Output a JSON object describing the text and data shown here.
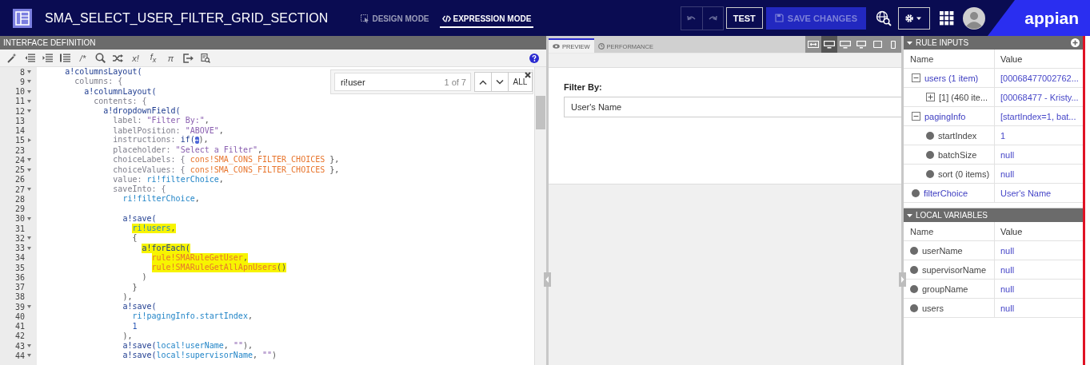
{
  "header": {
    "title": "SMA_SELECT_USER_FILTER_GRID_SECTION",
    "modes": [
      {
        "label": "DESIGN MODE",
        "kind": "design",
        "selected": false
      },
      {
        "label": "EXPRESSION MODE",
        "kind": "expression",
        "selected": true
      }
    ],
    "test": "TEST",
    "save": {
      "label": "SAVE CHANGES",
      "disabled": true
    },
    "logo": "appian"
  },
  "editor": {
    "title": "INTERFACE DEFINITION",
    "toolbar": [
      {
        "kind": "wand"
      },
      {
        "kind": "outdent"
      },
      {
        "kind": "indent"
      },
      {
        "kind": "lines"
      },
      {
        "kind": "text",
        "label": "/*"
      },
      {
        "kind": "search"
      },
      {
        "kind": "shuffle"
      },
      {
        "kind": "text",
        "label": "x!"
      },
      {
        "kind": "text",
        "label": "f$_{x}$"
      },
      {
        "kind": "text",
        "label": "π"
      },
      {
        "kind": "export"
      },
      {
        "kind": "inspect"
      }
    ],
    "find": {
      "value": "ri!user",
      "count": "1 of 7",
      "all": "ALL"
    },
    "lines": [
      {
        "num": "8",
        "expanded": true,
        "highlighted": false,
        "tokens": [
          {
            "kind": "fn",
            "text": "      a!columnsLayout("
          }
        ]
      },
      {
        "num": "9",
        "expanded": true,
        "highlighted": false,
        "tokens": [
          {
            "kind": "key",
            "text": "        columns: {"
          }
        ]
      },
      {
        "num": "10",
        "expanded": true,
        "highlighted": false,
        "tokens": [
          {
            "kind": "fn",
            "text": "          a!columnLayout("
          }
        ]
      },
      {
        "num": "11",
        "expanded": true,
        "highlighted": false,
        "tokens": [
          {
            "kind": "key",
            "text": "            contents: {"
          }
        ]
      },
      {
        "num": "12",
        "expanded": true,
        "highlighted": false,
        "tokens": [
          {
            "kind": "fn",
            "text": "              a!dropdownField("
          }
        ]
      },
      {
        "num": "13",
        "highlighted": false,
        "tokens": [
          {
            "kind": "key",
            "text": "                label: "
          },
          {
            "kind": "str",
            "text": "\"Filter By:\""
          },
          {
            "kind": "punct",
            "text": ","
          }
        ]
      },
      {
        "num": "14",
        "highlighted": false,
        "tokens": [
          {
            "kind": "key",
            "text": "                labelPosition: "
          },
          {
            "kind": "str",
            "text": "\"ABOVE\""
          },
          {
            "kind": "punct",
            "text": ","
          }
        ]
      },
      {
        "num": "15",
        "expanded": false,
        "highlighted": false,
        "tokens": [
          {
            "kind": "key",
            "text": "                instructions: "
          },
          {
            "kind": "fn",
            "text": "if("
          },
          {
            "kind": "folded",
            "text": "↔"
          },
          {
            "kind": "punct",
            "text": "),"
          }
        ]
      },
      {
        "num": "23",
        "highlighted": false,
        "tokens": [
          {
            "kind": "key",
            "text": "                placeholder: "
          },
          {
            "kind": "str",
            "text": "\"Select a Filter\""
          },
          {
            "kind": "punct",
            "text": ","
          }
        ]
      },
      {
        "num": "24",
        "expanded": true,
        "highlighted": false,
        "tokens": [
          {
            "kind": "key",
            "text": "                choiceLabels: { "
          },
          {
            "kind": "const",
            "text": "cons!SMA_CONS_FILTER_CHOICES"
          },
          {
            "kind": "punct",
            "text": " },"
          }
        ]
      },
      {
        "num": "25",
        "expanded": true,
        "highlighted": false,
        "tokens": [
          {
            "kind": "key",
            "text": "                choiceValues: { "
          },
          {
            "kind": "const",
            "text": "cons!SMA_CONS_FILTER_CHOICES"
          },
          {
            "kind": "punct",
            "text": " },"
          }
        ]
      },
      {
        "num": "26",
        "highlighted": false,
        "tokens": [
          {
            "kind": "key",
            "text": "                value: "
          },
          {
            "kind": "ref",
            "text": "ri!filterChoice"
          },
          {
            "kind": "punct",
            "text": ","
          }
        ]
      },
      {
        "num": "27",
        "expanded": true,
        "highlighted": false,
        "tokens": [
          {
            "kind": "key",
            "text": "                saveInto: {"
          }
        ]
      },
      {
        "num": "28",
        "highlighted": false,
        "tokens": [
          {
            "kind": "ref",
            "text": "                  ri!filterChoice"
          },
          {
            "kind": "punct",
            "text": ","
          }
        ]
      },
      {
        "num": "29"
      },
      {
        "num": "30",
        "expanded": true,
        "highlighted": false,
        "tokens": [
          {
            "kind": "fn",
            "text": "                  a!save("
          }
        ]
      },
      {
        "num": "31",
        "highlighted": true,
        "tokens": [
          {
            "kind": "ref",
            "text": "                    ri!users"
          },
          {
            "kind": "punct",
            "text": ","
          }
        ]
      },
      {
        "num": "32",
        "expanded": true,
        "highlighted": false,
        "tokens": [
          {
            "kind": "punct",
            "text": "                    {"
          }
        ]
      },
      {
        "num": "33",
        "expanded": true,
        "highlighted": true,
        "tokens": [
          {
            "kind": "fn",
            "text": "                      a!forEach("
          }
        ]
      },
      {
        "num": "34",
        "highlighted": true,
        "tokens": [
          {
            "kind": "const",
            "text": "                        rule!SMARuleGetUser"
          },
          {
            "kind": "punct",
            "text": ","
          }
        ]
      },
      {
        "num": "35",
        "highlighted": true,
        "tokens": [
          {
            "kind": "const",
            "text": "                        rule!SMARuleGetAllApnUsers"
          },
          {
            "kind": "punct",
            "text": "()"
          }
        ]
      },
      {
        "num": "36",
        "highlighted": false,
        "tokens": [
          {
            "kind": "punct",
            "text": "                      )"
          }
        ]
      },
      {
        "num": "37",
        "highlighted": false,
        "tokens": [
          {
            "kind": "punct",
            "text": "                    }"
          }
        ]
      },
      {
        "num": "38",
        "highlighted": false,
        "tokens": [
          {
            "kind": "punct",
            "text": "                  ),"
          }
        ]
      },
      {
        "num": "39",
        "expanded": true,
        "highlighted": false,
        "tokens": [
          {
            "kind": "fn",
            "text": "                  a!save("
          }
        ]
      },
      {
        "num": "40",
        "highlighted": false,
        "tokens": [
          {
            "kind": "ref",
            "text": "                    ri!pagingInfo.startIndex"
          },
          {
            "kind": "punct",
            "text": ","
          }
        ]
      },
      {
        "num": "41",
        "highlighted": false,
        "tokens": [
          {
            "kind": "num",
            "text": "                    1"
          }
        ]
      },
      {
        "num": "42",
        "highlighted": false,
        "tokens": [
          {
            "kind": "punct",
            "text": "                  ),"
          }
        ]
      },
      {
        "num": "43",
        "expanded": true,
        "highlighted": false,
        "tokens": [
          {
            "kind": "fn",
            "text": "                  a!save("
          },
          {
            "kind": "ref",
            "text": "local!userName"
          },
          {
            "kind": "punct",
            "text": ", "
          },
          {
            "kind": "str",
            "text": "\"\""
          },
          {
            "kind": "punct",
            "text": "),"
          }
        ]
      },
      {
        "num": "44",
        "expanded": true,
        "highlighted": false,
        "tokens": [
          {
            "kind": "fn",
            "text": "                  a!save("
          },
          {
            "kind": "ref",
            "text": "local!supervisorName"
          },
          {
            "kind": "punct",
            "text": ", "
          },
          {
            "kind": "str",
            "text": "\"\""
          },
          {
            "kind": "punct",
            "text": ")"
          }
        ]
      }
    ]
  },
  "preview": {
    "tabs": [
      {
        "label": "PREVIEW",
        "kind": "preview",
        "selected": true
      },
      {
        "label": "PERFORMANCE",
        "kind": "performance",
        "selected": false
      }
    ],
    "devices": [
      {
        "kind": "fit",
        "selected": false
      },
      {
        "kind": "desktop",
        "selected": true
      },
      {
        "kind": "desktop",
        "selected": false
      },
      {
        "kind": "monitor",
        "selected": false
      },
      {
        "kind": "tablet",
        "selected": false
      },
      {
        "kind": "phone",
        "selected": false
      }
    ],
    "field": {
      "label": "Filter By:",
      "value": "User's Name"
    }
  },
  "rule_inputs": {
    "title": "RULE INPUTS",
    "columns": [
      "Name",
      "Value"
    ],
    "items": [
      {
        "name": "users (1 item)",
        "value": "[00068477002762...",
        "expanded": true,
        "children": [
          {
            "name": "[1] (460 ite...",
            "value": "[00068477 - Kristy...",
            "expanded": false
          }
        ]
      },
      {
        "name": "pagingInfo",
        "value": "[startIndex=1, bat...",
        "expanded": true,
        "children": [
          {
            "name": "startIndex",
            "value": "1"
          },
          {
            "name": "batchSize",
            "value": "null"
          },
          {
            "name": "sort (0 items)",
            "value": "null"
          }
        ]
      },
      {
        "name": "filterChoice",
        "value": "User's Name"
      }
    ]
  },
  "local_variables": {
    "title": "LOCAL VARIABLES",
    "columns": [
      "Name",
      "Value"
    ],
    "items": [
      {
        "name": "userName",
        "value": "null"
      },
      {
        "name": "supervisorName",
        "value": "null"
      },
      {
        "name": "groupName",
        "value": "null"
      },
      {
        "name": "users",
        "value": "null"
      }
    ]
  }
}
